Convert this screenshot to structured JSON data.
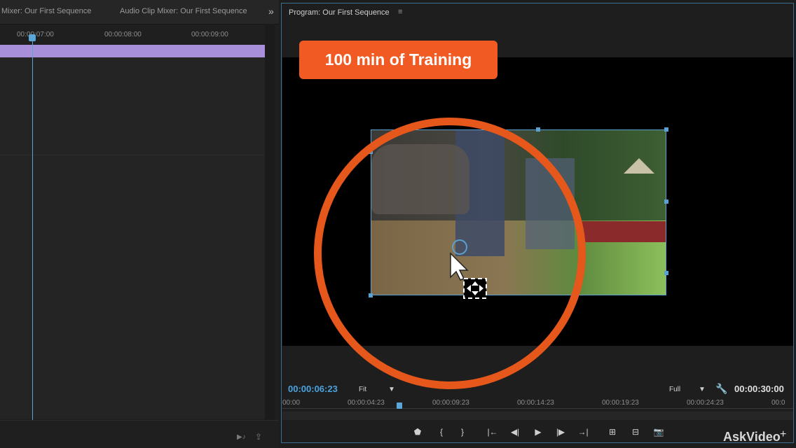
{
  "left_panel": {
    "tab1": "Mixer: Our First Sequence",
    "tab2": "Audio Clip Mixer: Our First Sequence",
    "overflow": "»",
    "ruler": [
      "00:00:07:00",
      "00:00:08:00",
      "00:00:09:00"
    ]
  },
  "program": {
    "title": "Program: Our First Sequence",
    "menu_icon": "≡",
    "timecode_current": "00:00:06:23",
    "timecode_duration": "00:00:30:00",
    "zoom_select": "Fit",
    "resolution_select": "Full",
    "ruler": [
      "00:00",
      "00:00:04:23",
      "00:00:09:23",
      "00:00:14:23",
      "00:00:19:23",
      "00:00:24:23",
      "00:0"
    ]
  },
  "controls": [
    {
      "name": "marker-icon",
      "glyph": "⬟"
    },
    {
      "name": "mark-in-icon",
      "glyph": "{"
    },
    {
      "name": "mark-out-icon",
      "glyph": "}"
    },
    {
      "name": "go-to-in-icon",
      "glyph": "|←"
    },
    {
      "name": "step-back-icon",
      "glyph": "◀|"
    },
    {
      "name": "play-icon",
      "glyph": "▶"
    },
    {
      "name": "step-forward-icon",
      "glyph": "|▶"
    },
    {
      "name": "go-to-out-icon",
      "glyph": "→|"
    },
    {
      "name": "lift-icon",
      "glyph": "⊞"
    },
    {
      "name": "extract-icon",
      "glyph": "⊟"
    },
    {
      "name": "export-frame-icon",
      "glyph": "📷"
    }
  ],
  "promo": "100 min of Training",
  "watermark": "AskVideo",
  "colors": {
    "accent": "#4aa3df",
    "promo_orange": "#f15a22",
    "ring_orange": "#e5571b",
    "clip_purple": "#a78fd9"
  }
}
